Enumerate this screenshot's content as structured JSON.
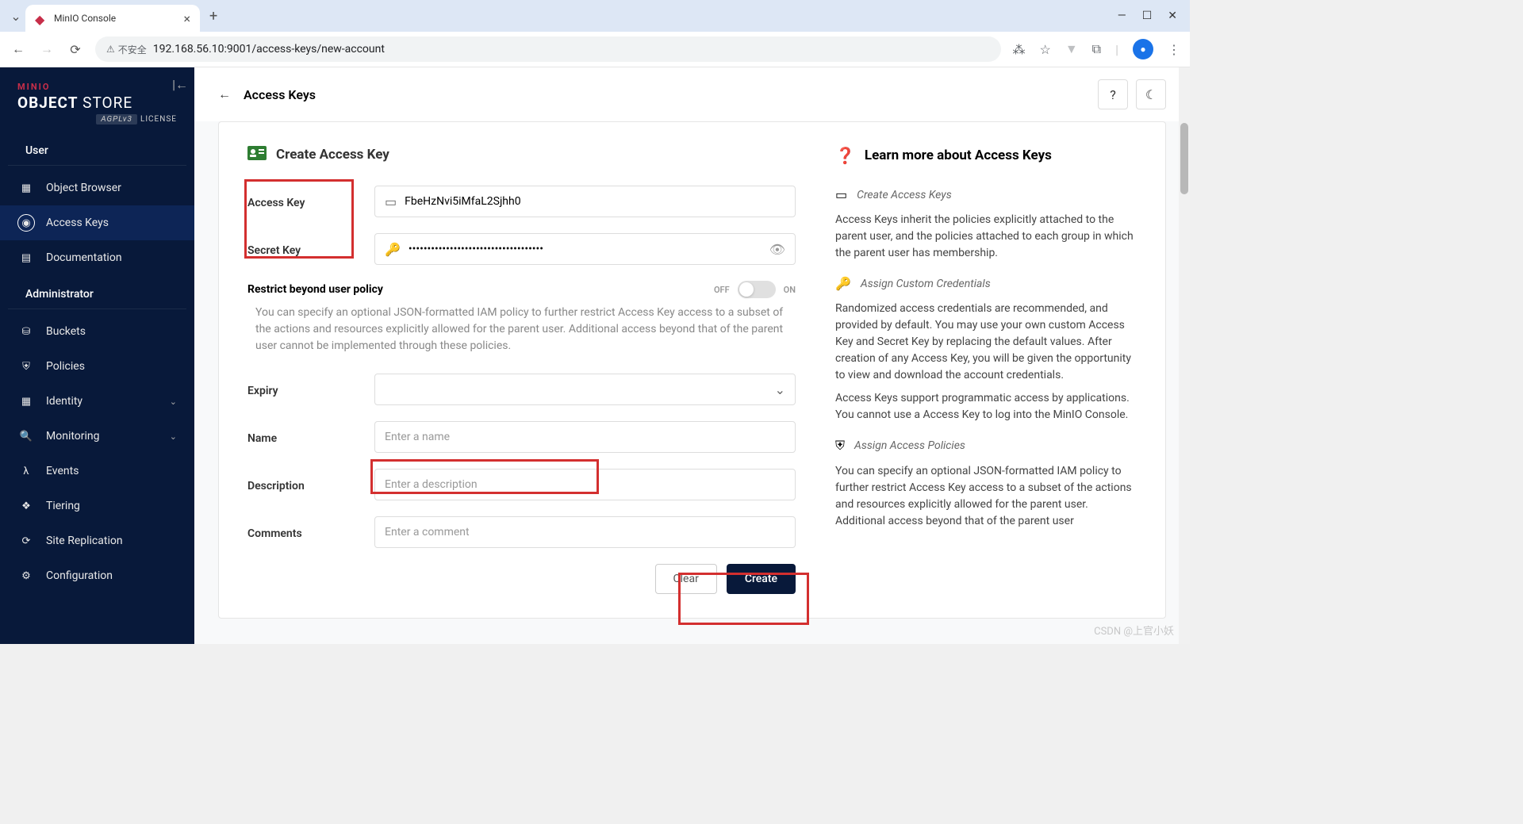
{
  "browser": {
    "tab_title": "MinIO Console",
    "insecure_label": "不安全",
    "url": "192.168.56.10:9001/access-keys/new-account"
  },
  "logo": {
    "brand": "MINIO",
    "product_bold": "OBJECT",
    "product_light": " STORE",
    "license_badge": "AGPLv3",
    "license_text": "LICENSE"
  },
  "sidebar": {
    "sections": [
      {
        "title": "User",
        "items": [
          {
            "label": "Object Browser",
            "icon": "▦"
          },
          {
            "label": "Access Keys",
            "icon": "◉",
            "active": true
          },
          {
            "label": "Documentation",
            "icon": "▤"
          }
        ]
      },
      {
        "title": "Administrator",
        "items": [
          {
            "label": "Buckets",
            "icon": "⛁"
          },
          {
            "label": "Policies",
            "icon": "⛨"
          },
          {
            "label": "Identity",
            "icon": "▦",
            "expandable": true
          },
          {
            "label": "Monitoring",
            "icon": "🔍",
            "expandable": true
          },
          {
            "label": "Events",
            "icon": "λ"
          },
          {
            "label": "Tiering",
            "icon": "❖"
          },
          {
            "label": "Site Replication",
            "icon": "⟳"
          },
          {
            "label": "Configuration",
            "icon": "⚙"
          }
        ]
      }
    ]
  },
  "topbar": {
    "title": "Access Keys"
  },
  "form": {
    "title": "Create Access Key",
    "fields": {
      "access_key": {
        "label": "Access Key",
        "value": "FbeHzNvi5iMfaL2Sjhh0"
      },
      "secret_key": {
        "label": "Secret Key",
        "value": "••••••••••••••••••••••••••••••••••••"
      },
      "restrict": {
        "label": "Restrict beyond user policy",
        "off": "OFF",
        "on": "ON",
        "help": "You can specify an optional JSON-formatted IAM policy to further restrict Access Key access to a subset of the actions and resources explicitly allowed for the parent user. Additional access beyond that of the parent user cannot be implemented through these policies."
      },
      "expiry": {
        "label": "Expiry"
      },
      "name": {
        "label": "Name",
        "placeholder": "Enter a name"
      },
      "description": {
        "label": "Description",
        "placeholder": "Enter a description"
      },
      "comments": {
        "label": "Comments",
        "placeholder": "Enter a comment"
      }
    },
    "buttons": {
      "clear": "Clear",
      "create": "Create"
    }
  },
  "info": {
    "title": "Learn more about Access Keys",
    "sections": [
      {
        "heading": "Create Access Keys",
        "body": "Access Keys inherit the policies explicitly attached to the parent user, and the policies attached to each group in which the parent user has membership."
      },
      {
        "heading": "Assign Custom Credentials",
        "body": "Randomized access credentials are recommended, and provided by default. You may use your own custom Access Key and Secret Key by replacing the default values. After creation of any Access Key, you will be given the opportunity to view and download the account credentials.",
        "body2": "Access Keys support programmatic access by applications. You cannot use a Access Key to log into the MinIO Console."
      },
      {
        "heading": "Assign Access Policies",
        "body": "You can specify an optional JSON-formatted IAM policy to further restrict Access Key access to a subset of the actions and resources explicitly allowed for the parent user. Additional access beyond that of the parent user"
      }
    ]
  },
  "watermark": "CSDN @上官小妖"
}
